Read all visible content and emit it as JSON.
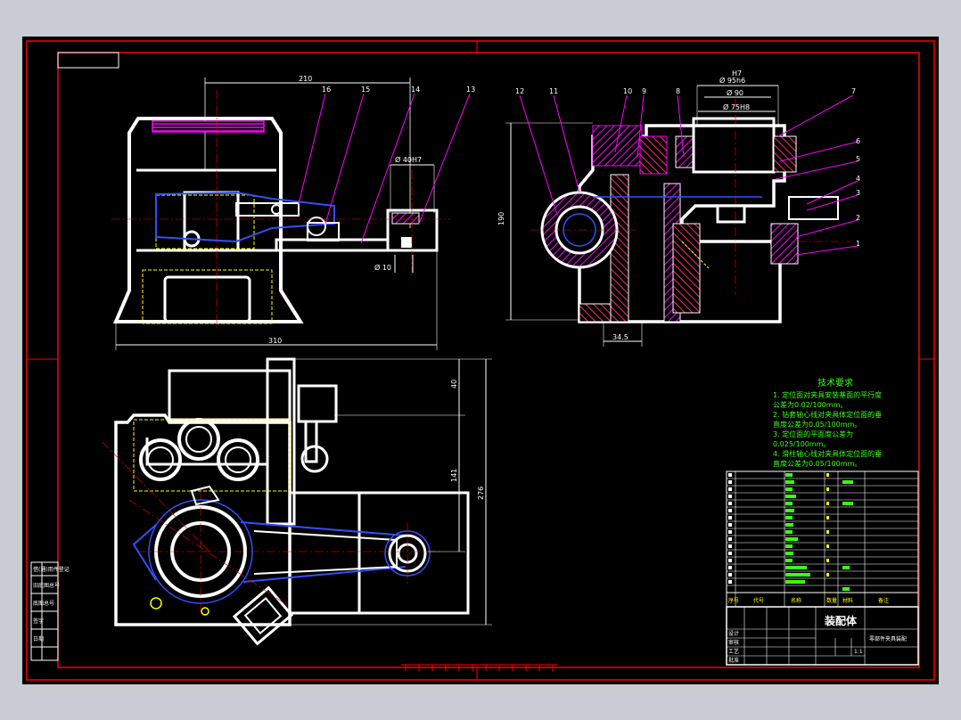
{
  "colors": {
    "sheet_bg": "#000000",
    "frame": "#ff0000",
    "outline": "#ffffff",
    "section_hatch": "#ff00ff",
    "leader": "#ff00ff",
    "hidden": "#ffff00",
    "part_blue": "#3050ff",
    "text_green": "#39ff14",
    "center": "#ff0000"
  },
  "front_view": {
    "dims": {
      "top_width": "210",
      "bottom_width": "310",
      "bore": "Ø 40H7",
      "pin": "Ø 10"
    },
    "balloons": [
      "16",
      "15",
      "14",
      "13"
    ]
  },
  "side_view": {
    "dims": {
      "d1": "Ø 95h6",
      "d2": "Ø 90",
      "d3": "Ø 75H8",
      "height": "190",
      "base": "34.5",
      "tol": "H7"
    },
    "balloons_top": [
      "12",
      "11",
      "10",
      "9",
      "8"
    ],
    "balloons_right": [
      "7",
      "6",
      "5",
      "4",
      "3",
      "2",
      "1"
    ]
  },
  "plan_view": {
    "dims": {
      "d_a": "40",
      "d_b": "141",
      "d_c": "276"
    }
  },
  "tech_requirements": {
    "title": "技术要求",
    "lines": [
      "1. 定位面对夹具安装基面的平行度",
      "公差为0.02/100mm。",
      "2. 钻套轴心线对夹具体定位面的垂",
      "直度公差为0.05/100mm。",
      "3. 定位面的平面度公差为",
      "0.025/100mm。",
      "4. 滑柱轴心线对夹具体定位面的垂",
      "直度公差为0.05/100mm。"
    ]
  },
  "title_block": {
    "drawing_name": "装配体",
    "product_name": "零部件夹具装配",
    "scale": "1:1",
    "row_labels": [
      "设计",
      "审核",
      "工艺",
      "批准"
    ],
    "cols": [
      "序号",
      "代号",
      "名称",
      "数量",
      "材料",
      "备注"
    ]
  },
  "left_strip": {
    "labels": [
      "借(通)用件登记",
      "旧底图总号",
      "底图总号",
      "签字",
      "日期"
    ]
  }
}
